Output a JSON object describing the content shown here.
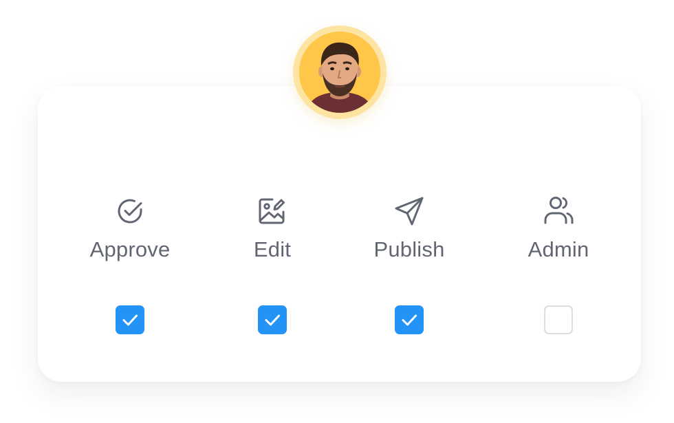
{
  "user": {
    "avatar_icon": "user-avatar-photo"
  },
  "colors": {
    "accent": "#2393f7",
    "avatar_ring": "#fde4a3",
    "avatar_bg": "#ffc64a",
    "label_text": "#626673",
    "unchecked_border": "#dcdde2"
  },
  "permissions": [
    {
      "label": "Approve",
      "icon": "check-circle-icon",
      "checked": true
    },
    {
      "label": "Edit",
      "icon": "image-edit-icon",
      "checked": true
    },
    {
      "label": "Publish",
      "icon": "send-icon",
      "checked": true
    },
    {
      "label": "Admin",
      "icon": "users-icon",
      "checked": false
    }
  ]
}
